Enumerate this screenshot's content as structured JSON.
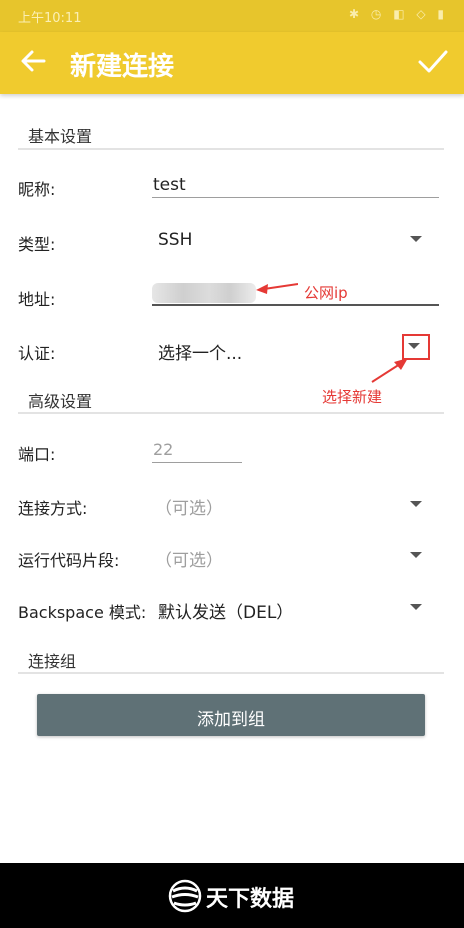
{
  "status_bar": {
    "time": "上午10:11",
    "icons": "✱ ◷ ◧ ◇ ▮"
  },
  "app_bar": {
    "title": "新建连接"
  },
  "sections": {
    "basic": "基本设置",
    "advanced": "高级设置",
    "group": "连接组"
  },
  "fields": {
    "nickname": {
      "label": "昵称:",
      "value": "test"
    },
    "type": {
      "label": "类型:",
      "value": "SSH"
    },
    "address": {
      "label": "地址:"
    },
    "auth": {
      "label": "认证:",
      "value": "选择一个..."
    },
    "port": {
      "label": "端口:",
      "placeholder": "22"
    },
    "connect_method": {
      "label": "连接方式:",
      "value": "（可选）"
    },
    "snippet": {
      "label": "运行代码片段:",
      "value": "（可选）"
    },
    "backspace": {
      "label": "Backspace 模式:",
      "value": "默认发送（DEL）"
    }
  },
  "annotations": {
    "address_note": "公网ip",
    "auth_note": "选择新建"
  },
  "add_group_button": "添加到组",
  "watermark": "天下数据",
  "colors": {
    "accent": "#f0cb2e",
    "button": "#5f7176",
    "annotation": "#e53935"
  }
}
